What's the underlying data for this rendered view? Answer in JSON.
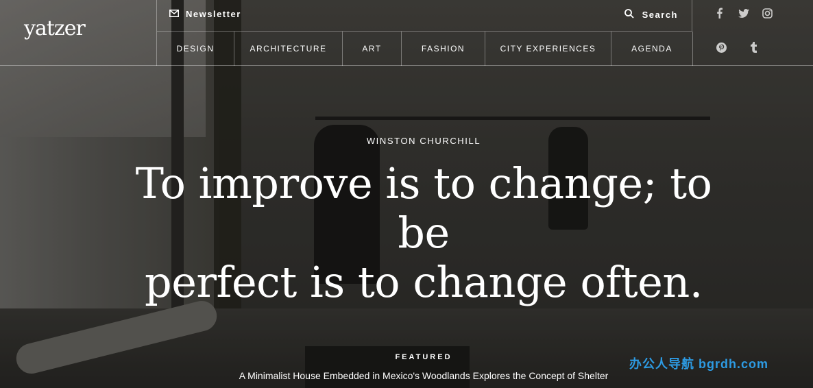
{
  "header": {
    "logo": "yatzer",
    "newsletter_label": "Newsletter",
    "search_label": "Search",
    "nav": [
      {
        "label": "DESIGN"
      },
      {
        "label": "ARCHITECTURE"
      },
      {
        "label": "ART"
      },
      {
        "label": "FASHION"
      },
      {
        "label": "CITY EXPERIENCES"
      },
      {
        "label": "AGENDA"
      }
    ],
    "social_icons": [
      "facebook-icon",
      "twitter-icon",
      "instagram-icon",
      "pinterest-icon",
      "tumblr-icon"
    ]
  },
  "hero": {
    "author": "WINSTON CHURCHILL",
    "quote_line1": "To improve is to change; to be",
    "quote_line2": "perfect is to change often."
  },
  "featured": {
    "label": "FEATURED",
    "title": "A Minimalist House Embedded in Mexico's Woodlands Explores the Concept of Shelter"
  },
  "watermark": "办公人导航  bgrdh.com",
  "colors": {
    "text": "#ffffff",
    "watermark": "#2d9be3",
    "divider": "rgba(255,255,255,0.35)"
  }
}
